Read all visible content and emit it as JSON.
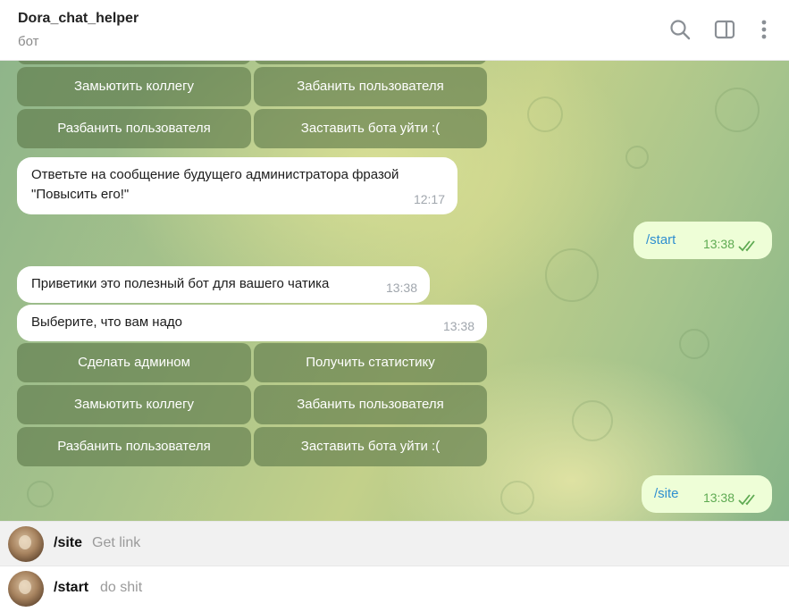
{
  "header": {
    "title": "Dora_chat_helper",
    "subtitle": "бот",
    "icons": [
      "search-icon",
      "sidebar-toggle-icon",
      "more-vertical-icon"
    ]
  },
  "keyboard_top_partial": {
    "row1": [
      "Замьютить коллегу",
      "Забанить пользователя"
    ],
    "row2": [
      "Разбанить пользователя",
      "Заставить бота уйти :("
    ]
  },
  "messages": {
    "m1": {
      "text": "Ответьте на сообщение будущего администратора фразой \"Повысить его!\"",
      "time": "12:17"
    },
    "m2": {
      "text": "/start",
      "time": "13:38"
    },
    "m3": {
      "text": "Приветики это полезный бот для вашего чатика",
      "time": "13:38"
    },
    "m4": {
      "text": "Выберите, что вам надо",
      "time": "13:38"
    },
    "m5": {
      "text": "/site",
      "time": "13:38"
    }
  },
  "keyboard": {
    "row1": [
      "Сделать админом",
      "Получить статистику"
    ],
    "row2": [
      "Замьютить коллегу",
      "Забанить пользователя"
    ],
    "row3": [
      "Разбанить пользователя",
      "Заставить бота уйти :("
    ]
  },
  "commands": [
    {
      "name": "/site",
      "description": "Get link"
    },
    {
      "name": "/start",
      "description": "do shit"
    }
  ],
  "colors": {
    "outgoing_bubble": "#eefed7",
    "outgoing_text": "#2f8fd0",
    "read_ticks": "#5eaa52",
    "keyboard_button": "#5c7848"
  }
}
